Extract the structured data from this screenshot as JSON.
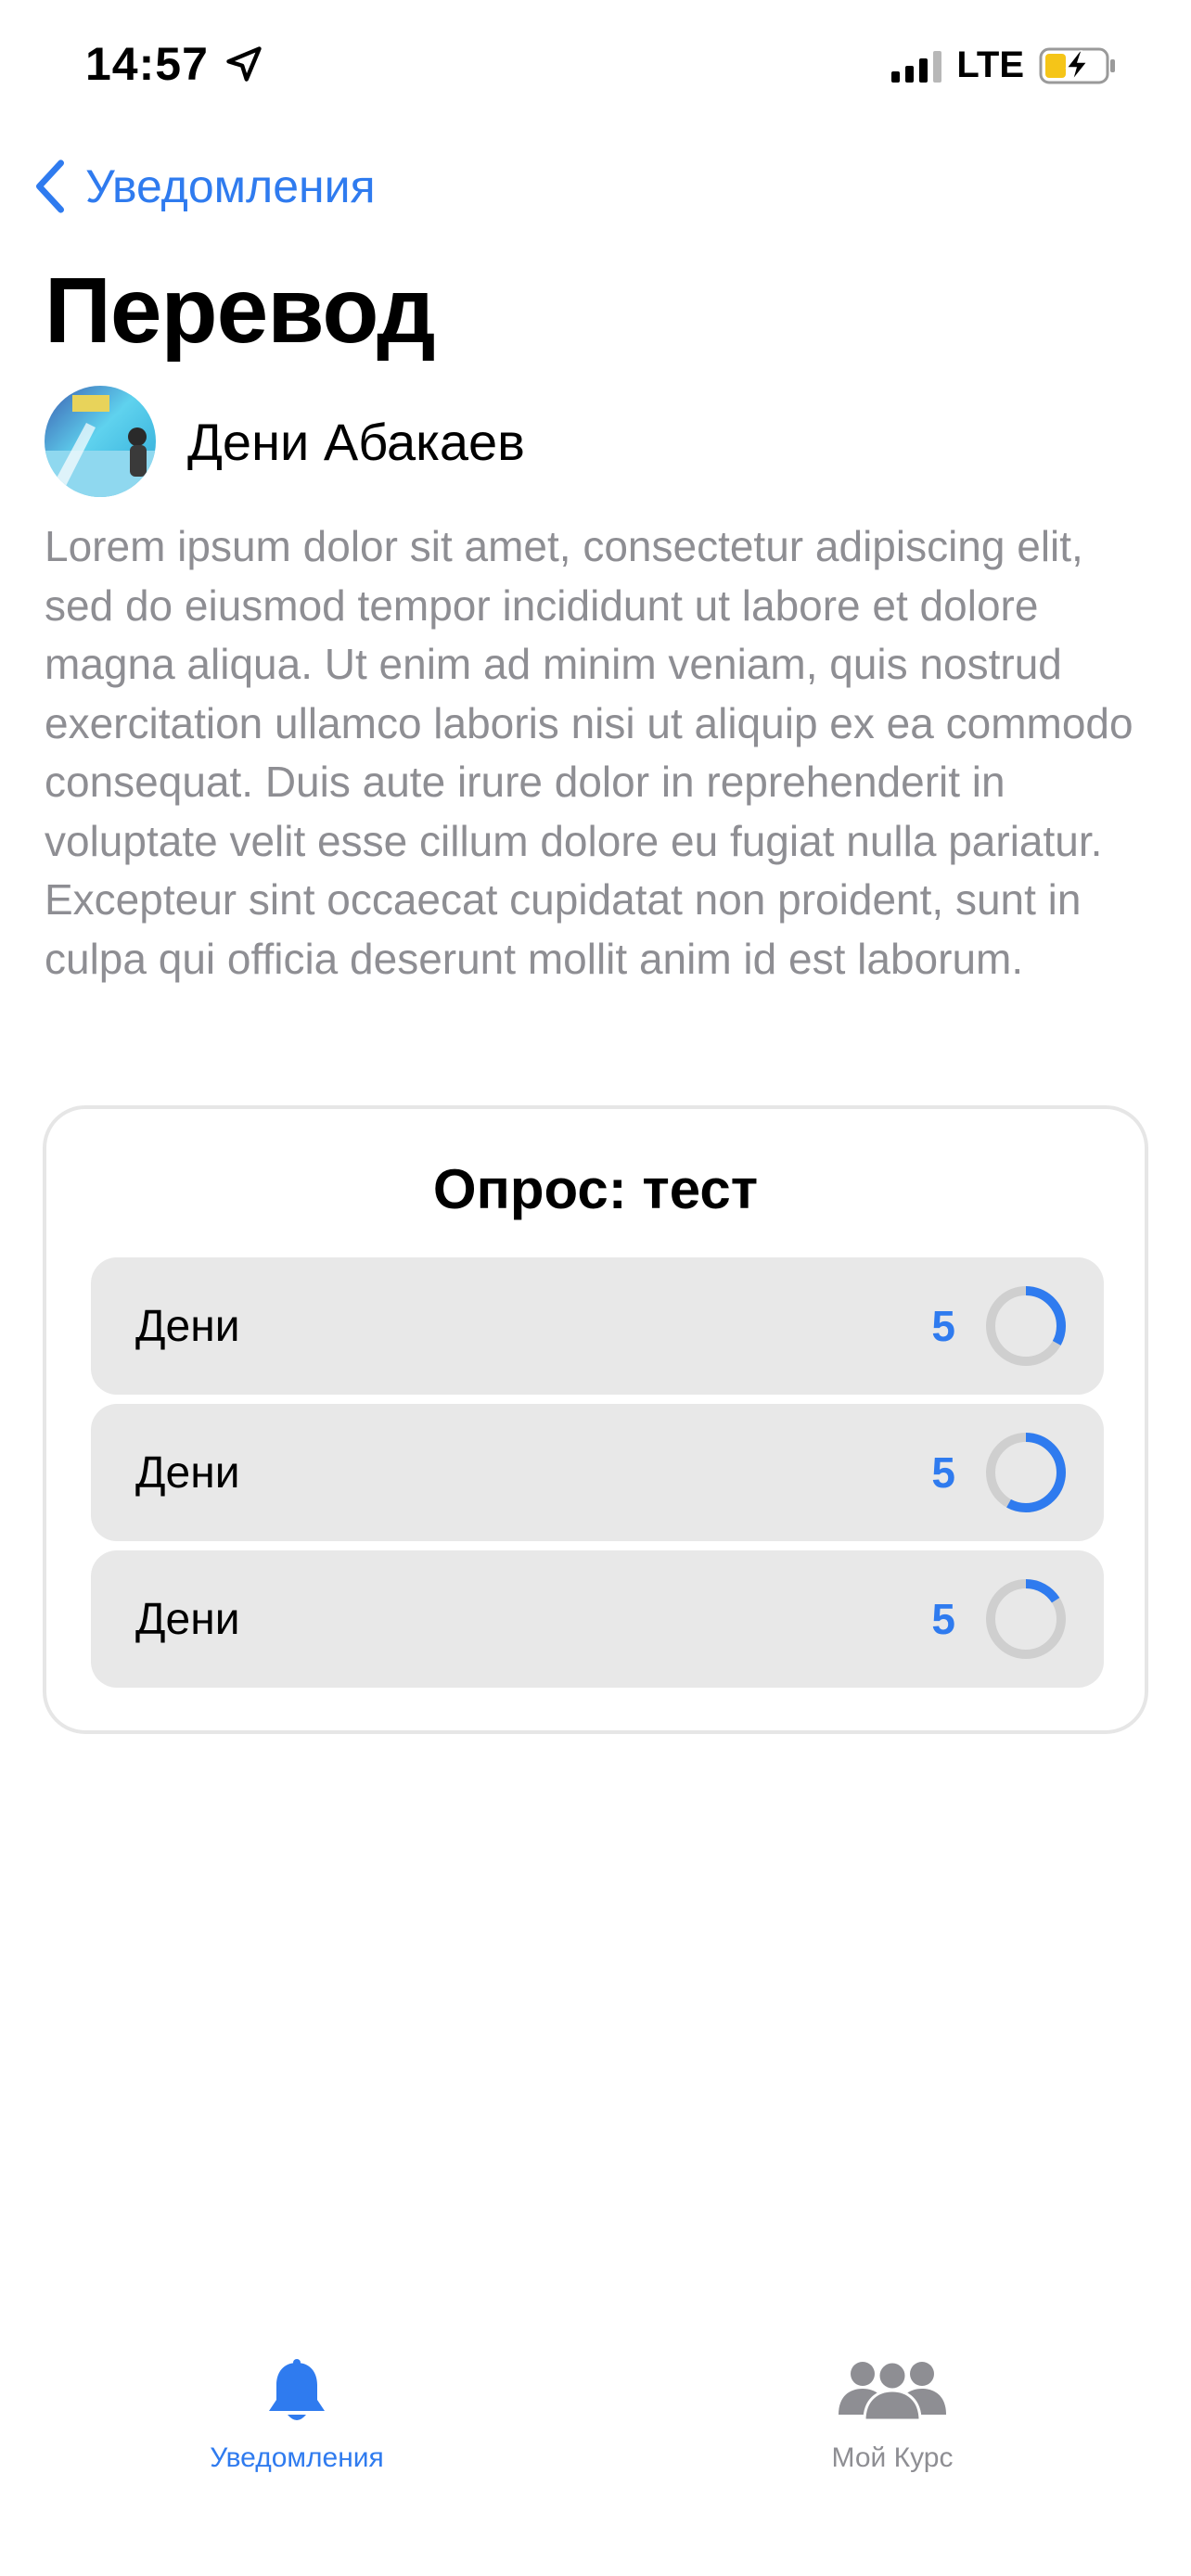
{
  "status_bar": {
    "time": "14:57",
    "network": "LTE"
  },
  "nav": {
    "back_label": "Уведомления"
  },
  "page": {
    "title": "Перевод",
    "author_name": "Дени Абакаев",
    "body": "Lorem ipsum dolor sit amet, consectetur adipiscing elit, sed do eiusmod tempor incididunt ut labore et dolore magna aliqua. Ut enim ad minim veniam, quis nostrud exercitation ullamco laboris nisi ut aliquip ex ea commodo consequat. Duis aute irure dolor in reprehenderit in voluptate velit esse cillum dolore eu fugiat nulla pariatur. Excepteur sint occaecat cupidatat non proident, sunt in culpa qui officia deserunt mollit anim id est laborum."
  },
  "poll": {
    "title": "Опрос: тест",
    "options": [
      {
        "label": "Дени",
        "count": "5",
        "fraction": 0.33
      },
      {
        "label": "Дени",
        "count": "5",
        "fraction": 0.58
      },
      {
        "label": "Дени",
        "count": "5",
        "fraction": 0.16
      }
    ]
  },
  "tab_bar": {
    "tabs": [
      {
        "label": "Уведомления",
        "icon": "bell-icon",
        "active": true
      },
      {
        "label": "Мой Курс",
        "icon": "group-icon",
        "active": false
      }
    ]
  },
  "colors": {
    "accent": "#2F7BEF",
    "secondary_text": "#8e8e93",
    "option_bg": "#e8e8e8",
    "ring_track": "#cfcfcf"
  }
}
